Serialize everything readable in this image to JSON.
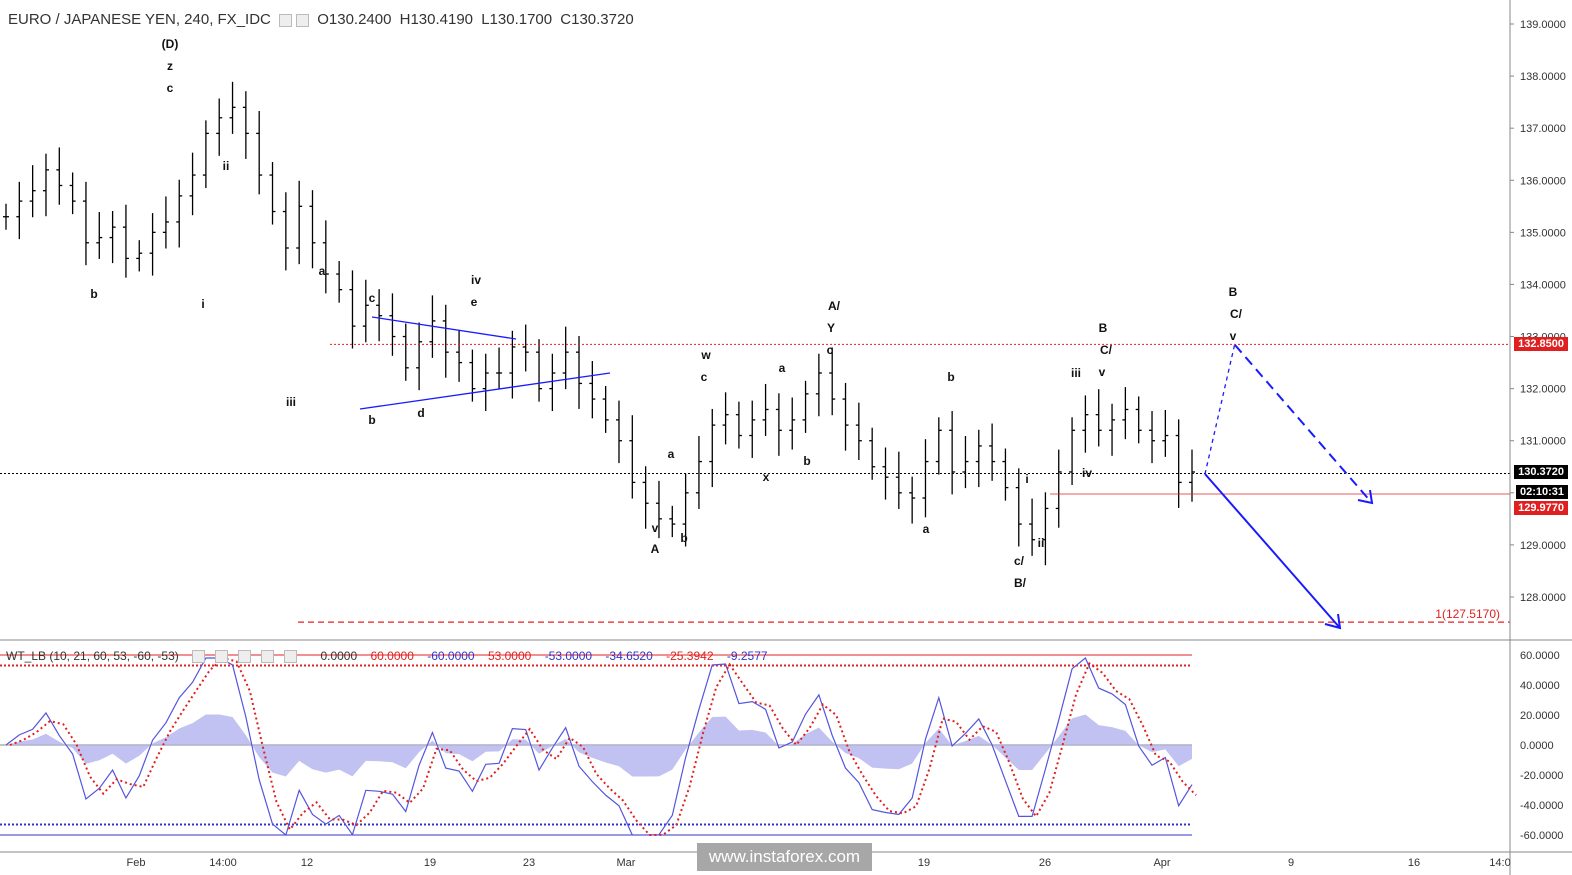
{
  "header": {
    "symbol": "EURO / JAPANESE YEN, 240, FX_IDC",
    "open": "O130.2400",
    "high": "H130.4190",
    "low": "L130.1700",
    "close": "C130.3720"
  },
  "oscillator": {
    "name": "WT_LB (10, 21, 60, 53, -60, -53)",
    "values": [
      "0.0000",
      "60.0000",
      "-60.0000",
      "53.0000",
      "-53.0000",
      "-34.6520",
      "-25.3942",
      "-9.2577"
    ],
    "value_colors": [
      "#555555",
      "#e02020",
      "#3333cc",
      "#e02020",
      "#3333cc",
      "#3333cc",
      "#e02020",
      "#3333cc"
    ],
    "levels": [
      60,
      -60,
      53,
      -53
    ],
    "axis_labels": [
      "60.0000",
      "40.0000",
      "20.0000",
      "0.0000",
      "-20.0000",
      "-40.0000",
      "-60.0000"
    ]
  },
  "price_tags": {
    "current": "130.3720",
    "countdown": "02:10:31",
    "resistance": "132.8500",
    "low_line": "129.9770"
  },
  "watermark": "www.instaforex.com",
  "target_label": "1(127.5170)",
  "colors": {
    "up": "#000000",
    "blue": "#1a1aff",
    "red": "#e02020",
    "osc_fill": "#b3b3ef"
  },
  "chart_data": {
    "type": "ohlc",
    "title": "EURO / JAPANESE YEN, 240, FX_IDC",
    "ylim": [
      127.0,
      139.2
    ],
    "y_ticks": [
      "139.0000",
      "138.0000",
      "137.0000",
      "136.0000",
      "135.0000",
      "134.0000",
      "133.0000",
      "132.0000",
      "131.0000",
      "130.0000",
      "129.0000",
      "128.0000"
    ],
    "x_ticks": [
      "Feb",
      "14:00",
      "12",
      "19",
      "23",
      "Mar",
      "12",
      "19",
      "26",
      "Apr",
      "9",
      "16",
      "14:0"
    ],
    "series_close": [
      135.3,
      135.6,
      135.8,
      136.2,
      135.9,
      135.6,
      134.8,
      134.9,
      135.1,
      134.5,
      134.6,
      135.0,
      135.2,
      135.7,
      136.1,
      136.9,
      137.2,
      137.4,
      136.9,
      136.1,
      135.4,
      134.7,
      135.5,
      134.8,
      134.2,
      133.9,
      133.2,
      133.6,
      133.4,
      133.0,
      132.4,
      132.9,
      133.3,
      132.7,
      132.5,
      132.0,
      132.3,
      132.3,
      132.8,
      132.7,
      132.0,
      132.3,
      132.7,
      132.1,
      131.8,
      131.4,
      131.0,
      130.2,
      129.8,
      129.5,
      129.4,
      130.0,
      130.6,
      131.3,
      131.5,
      131.1,
      131.4,
      131.6,
      131.2,
      131.4,
      131.9,
      132.3,
      131.8,
      131.3,
      131.0,
      130.5,
      130.3,
      130.0,
      129.9,
      130.6,
      131.2,
      130.4,
      130.6,
      130.9,
      130.6,
      130.1,
      129.4,
      129.1,
      129.7,
      130.4,
      131.2,
      131.5,
      131.2,
      131.4,
      131.6,
      131.2,
      131.0,
      131.1,
      130.2,
      130.4
    ],
    "current_price": 130.372,
    "horizontal_levels": [
      132.85,
      129.977,
      127.517
    ],
    "target": "1(127.5170)",
    "wave_labels": [
      "(D)",
      "z",
      "c",
      "ii",
      "b",
      "i",
      "iii",
      "a",
      "c",
      "b",
      "d",
      "iv",
      "e",
      "w",
      "c",
      "v",
      "A",
      "a",
      "b",
      "x",
      "a",
      "b",
      "A/",
      "Y",
      "c",
      "b",
      "a",
      "i",
      "ii",
      "c/",
      "B/",
      "iii",
      "iv",
      "B",
      "C/",
      "v",
      "B",
      "C/",
      "v"
    ]
  }
}
